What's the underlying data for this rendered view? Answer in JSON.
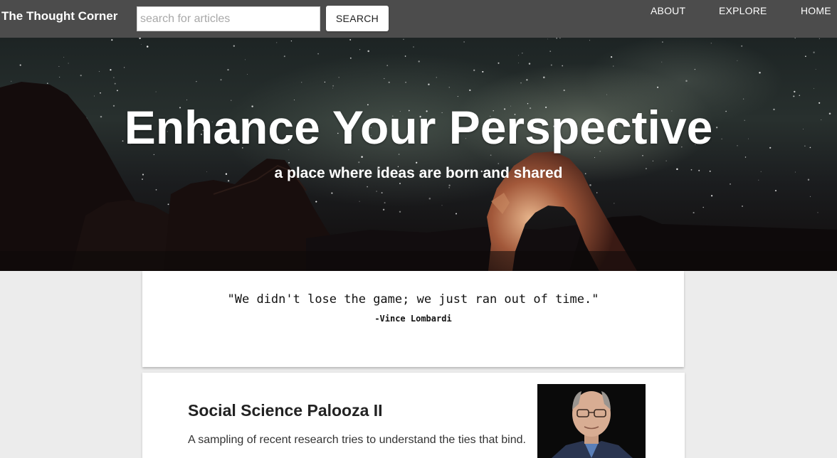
{
  "header": {
    "brand": "The Thought Corner",
    "search": {
      "placeholder": "search for articles",
      "value": ""
    },
    "search_button_label": "SEARCH",
    "nav": [
      {
        "label": "ABOUT"
      },
      {
        "label": "EXPLORE"
      },
      {
        "label": "HOME"
      }
    ]
  },
  "hero": {
    "title": "Enhance Your Perspective",
    "subtitle": "a place where ideas are born and shared"
  },
  "quote": {
    "text": "\"We didn't lose the game; we just ran out of time.\"",
    "author": "-Vince Lombardi"
  },
  "articles": [
    {
      "title": "Social Science Palooza II",
      "summary": "A sampling of recent research tries to understand the ties that bind."
    }
  ]
}
